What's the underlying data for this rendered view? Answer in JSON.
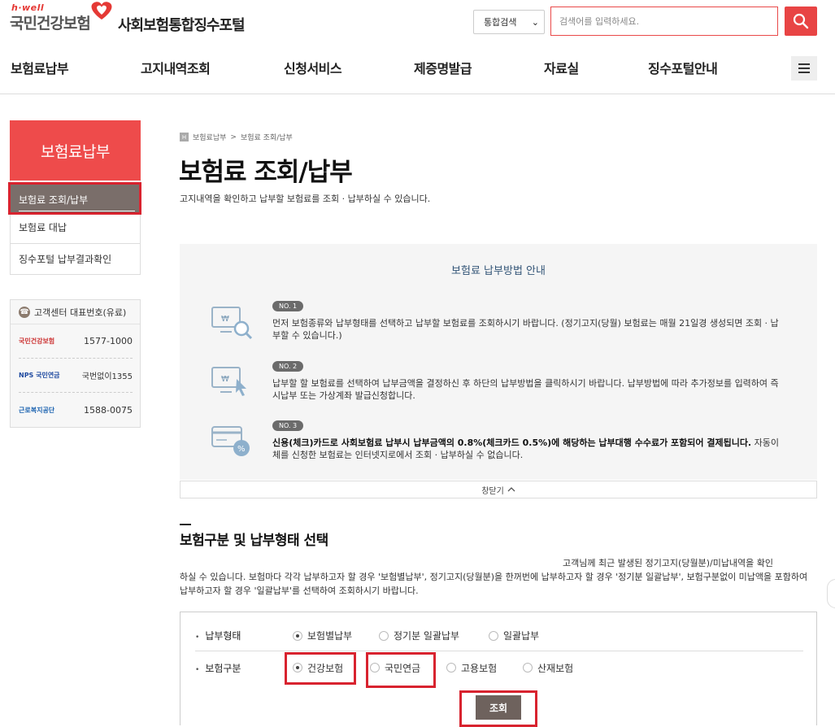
{
  "brand": {
    "hwell": "h·well",
    "logo_text": "국민건강보험",
    "portal_title": "사회보험통합징수포털"
  },
  "search": {
    "scope": "통합검색",
    "placeholder": "검색어를 입력하세요."
  },
  "gnb": [
    "보험료납부",
    "고지내역조회",
    "신청서비스",
    "제증명발급",
    "자료실",
    "징수포털안내"
  ],
  "sidebar": {
    "title": "보험료납부",
    "items": [
      {
        "label": "보험료 조회/납부"
      },
      {
        "label": "보험료 대납"
      },
      {
        "label": "징수포털 납부결과확인"
      }
    ],
    "cs_title": "고객센터 대표번호(유료)",
    "contacts": [
      {
        "org": "국민건강보험",
        "number": "1577-1000"
      },
      {
        "org": "NPS 국민연금",
        "number": "국번없이1355"
      },
      {
        "org": "근로복지공단",
        "number": "1588-0075"
      }
    ]
  },
  "breadcrumb": {
    "items": [
      "보험료납부",
      ">",
      "보험료 조회/납부"
    ]
  },
  "page": {
    "title": "보험료 조회/납부",
    "desc": "고지내역을 확인하고 납부할 보험료를 조회 · 납부하실 수 있습니다."
  },
  "guide": {
    "title": "보험료 납부방법 안내",
    "steps": [
      {
        "no": "NO. 1",
        "text": "먼저 보험종류와 납부형태를 선택하고 납부할 보험료를 조회하시기 바랍니다. (정기고지(당월) 보험료는 매월 21일경 생성되면 조회 · 납부할 수 있습니다.)",
        "bold": ""
      },
      {
        "no": "NO. 2",
        "text": "납부할 할 보험료를 선택하여 납부금액을 결정하신 후 하단의 납부방법을 클릭하시기 바랍니다. 납부방법에 따라 추가정보를 입력하여 즉시납부 또는 가상계좌 발급신청합니다.",
        "bold": ""
      },
      {
        "no": "NO. 3",
        "bold": "신용(체크)카드로 사회보험료 납부시 납부금액의 0.8%(체크카드 0.5%)에 해당하는 납부대행 수수료가 포함되어 결제됩니다.",
        "text": " 자동이체를 신청한 보험료는 인터넷지로에서 조회 · 납부하실 수 없습니다."
      }
    ],
    "close_label": "창닫기",
    "close_icon": "chevron-up"
  },
  "section": {
    "title": "보험구분 및 납부형태 선택",
    "desc1": "고객님께 최근 발생된 정기고지(당월분)/미납내역을 확인",
    "desc2": "하실 수 있습니다. 보험마다 각각 납부하고자 할 경우 '보험별납부', 정기고지(당월분)을 한꺼번에 납부하고자 할 경우 '정기분 일괄납부', 보험구분없이 미납액을 포함하여 납부하고자 할 경우 '일괄납부'를 선택하여 조회하시기 바랍니다."
  },
  "form": {
    "pay_type_label": "납부형태",
    "pay_types": [
      {
        "label": "보험별납부",
        "selected": true
      },
      {
        "label": "정기분 일괄납부",
        "selected": false
      },
      {
        "label": "일괄납부",
        "selected": false
      }
    ],
    "ins_type_label": "보험구분",
    "ins_types": [
      {
        "label": "건강보험",
        "selected": true
      },
      {
        "label": "국민연금",
        "selected": false
      },
      {
        "label": "고용보험",
        "selected": false
      },
      {
        "label": "산재보험",
        "selected": false
      }
    ],
    "submit_label": "조회"
  },
  "colors": {
    "brand_red": "#ee4b4b",
    "highlight": "#d8232f",
    "sidebar_active": "#7a6e6a",
    "button": "#6e625d"
  }
}
